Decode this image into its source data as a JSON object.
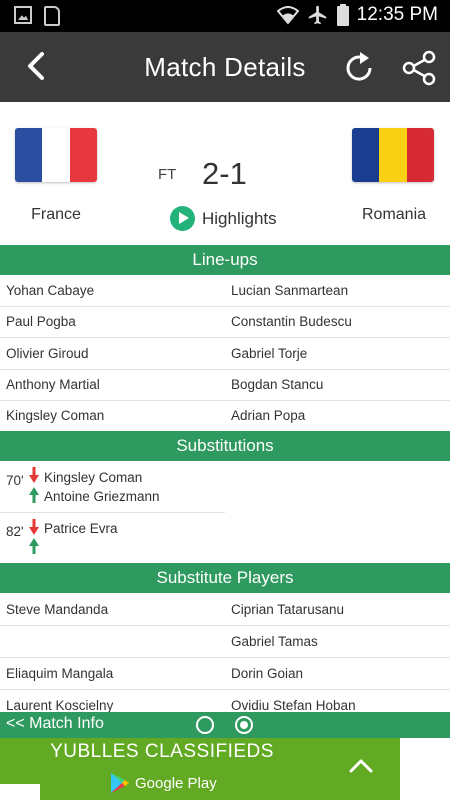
{
  "status_bar": {
    "time": "12:35 PM",
    "icons": [
      "image-icon",
      "sdcard-icon",
      "wifi-icon",
      "airplane-icon",
      "battery-icon"
    ]
  },
  "toolbar": {
    "title": "Match Details",
    "back_icon": "back-arrow-icon",
    "refresh_icon": "refresh-icon",
    "share_icon": "share-icon"
  },
  "match": {
    "home_team": "France",
    "away_team": "Romania",
    "status": "FT",
    "score": "2-1",
    "highlights_label": "Highlights",
    "home_flag_colors": [
      "#2b4ea0",
      "#ffffff",
      "#e8383f"
    ],
    "away_flag_colors": [
      "#1a3d8f",
      "#fbd116",
      "#d62b35"
    ]
  },
  "lineups": {
    "title": "Line-ups",
    "rows": [
      {
        "home": "Yohan Cabaye",
        "away": "Lucian Sanmartean"
      },
      {
        "home": "Paul Pogba",
        "away": "Constantin Budescu"
      },
      {
        "home": "Olivier Giroud",
        "away": "Gabriel Torje"
      },
      {
        "home": "Anthony Martial",
        "away": "Bogdan Stancu"
      },
      {
        "home": "Kingsley Coman",
        "away": "Adrian Popa"
      }
    ]
  },
  "substitutions": {
    "title": "Substitutions",
    "items": [
      {
        "minute": "70'",
        "out": "Kingsley Coman",
        "in": "Antoine Griezmann"
      },
      {
        "minute": "82'",
        "out": "Patrice Evra",
        "in": ""
      }
    ]
  },
  "substitute_players": {
    "title": "Substitute Players",
    "rows": [
      {
        "home": "Steve Mandanda",
        "away": "Ciprian Tatarusanu"
      },
      {
        "home": "",
        "away": "Gabriel Tamas"
      },
      {
        "home": "Eliaquim Mangala",
        "away": "Dorin Goian"
      },
      {
        "home": "Laurent Koscielny",
        "away": "Ovidiu Stefan Hoban"
      }
    ]
  },
  "bottom_nav": {
    "match_info_label": "<< Match Info",
    "page_dots": 2,
    "active_dot": 2
  },
  "ad": {
    "title": "YUBLLES CLASSIFIEDS",
    "store_label": "Google Play",
    "bg_color": "#62aa24"
  },
  "colors": {
    "toolbar": "#3a3a3a",
    "section_green": "#2e9a5f",
    "highlight_green": "#23b37a",
    "sub_out_red": "#e53935",
    "sub_in_green": "#2e9a5f"
  }
}
